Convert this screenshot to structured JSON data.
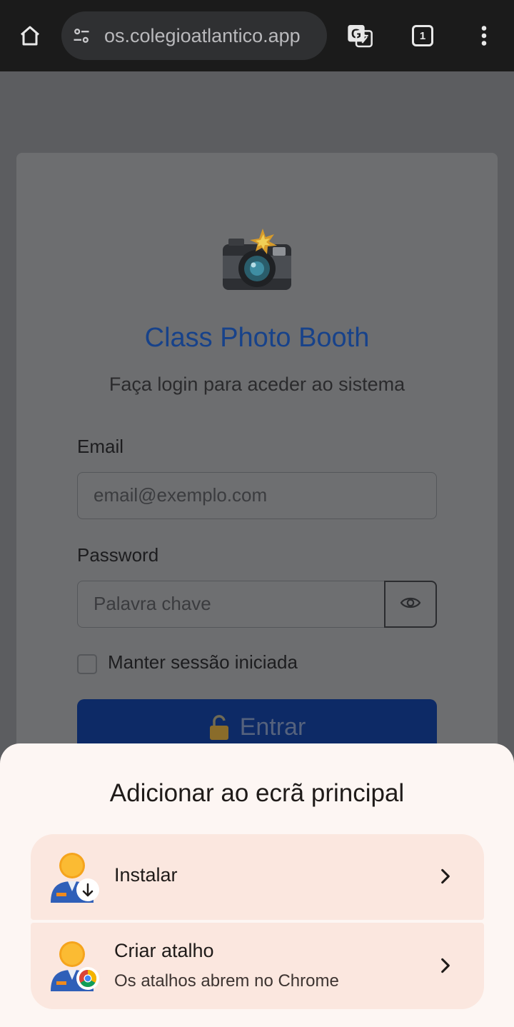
{
  "browser": {
    "url": "os.colegioatlantico.app",
    "tab_count": "1",
    "icons": [
      "home-icon",
      "site-settings-icon",
      "translate-icon",
      "tab-switcher-icon",
      "more-vert-icon"
    ]
  },
  "login": {
    "logo_icon": "camera-with-flash-icon",
    "title": "Class Photo Booth",
    "subtitle": "Faça login para aceder ao sistema",
    "email_label": "Email",
    "email_placeholder": "email@exemplo.com",
    "password_label": "Password",
    "password_placeholder": "Palavra chave",
    "remember_label": "Manter sessão iniciada",
    "submit_label": "Entrar",
    "submit_icon": "unlock-icon",
    "colors": {
      "title": "#17428a",
      "submit": "#0d2a66"
    }
  },
  "sheet": {
    "title": "Adicionar ao ecrã principal",
    "options": [
      {
        "label": "Instalar",
        "sublabel": "",
        "icon": "app-install-icon"
      },
      {
        "label": "Criar atalho",
        "sublabel": "Os atalhos abrem no Chrome",
        "icon": "app-shortcut-chrome-icon"
      }
    ],
    "colors": {
      "background": "#fdf6f3",
      "option_bg": "#fbe7df"
    }
  }
}
